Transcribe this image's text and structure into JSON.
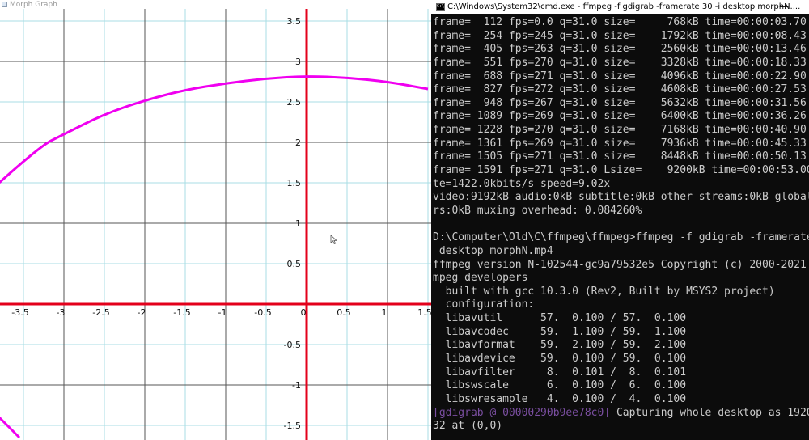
{
  "graph_window": {
    "title": "Morph Graph",
    "colors": {
      "background": "#ffffff",
      "minor_grid": "#a8dde4",
      "major_grid": "#555555",
      "axes": "#e3001b",
      "curve": "#f000f0"
    },
    "x_ticks": [
      "-3.5",
      "-3",
      "-2.5",
      "-2",
      "-1.5",
      "-1",
      "-0.5",
      "0",
      "0.5",
      "1",
      "1.5"
    ],
    "y_ticks": [
      "3.5",
      "3",
      "2.5",
      "2",
      "1.5",
      "1",
      "0.5",
      "-0.5",
      "-1",
      "-1.5"
    ],
    "curve": {
      "description_type": "arc",
      "points": [
        [
          -3.8,
          1.5
        ],
        [
          -3.3,
          1.95
        ],
        [
          -3.0,
          2.1
        ],
        [
          -2.5,
          2.35
        ],
        [
          -2.0,
          2.52
        ],
        [
          -1.5,
          2.65
        ],
        [
          -1.0,
          2.73
        ],
        [
          -0.5,
          2.79
        ],
        [
          0.0,
          2.82
        ],
        [
          0.5,
          2.8
        ],
        [
          1.0,
          2.75
        ],
        [
          1.5,
          2.66
        ]
      ],
      "lower_points": [
        [
          -3.8,
          -1.4
        ],
        [
          -3.65,
          -1.55
        ],
        [
          -3.55,
          -1.65
        ]
      ]
    }
  },
  "console_window": {
    "title": "C:\\Windows\\System32\\cmd.exe - ffmpeg  -f gdigrab -framerate 30 -i desktop morphN....",
    "minimize_label": "—",
    "icon_label": "C:\\",
    "lines": [
      "frame=  112 fps=0.0 q=31.0 size=     768kB time=00:00:03.70",
      "frame=  254 fps=245 q=31.0 size=    1792kB time=00:00:08.43",
      "frame=  405 fps=263 q=31.0 size=    2560kB time=00:00:13.46",
      "frame=  551 fps=270 q=31.0 size=    3328kB time=00:00:18.33",
      "frame=  688 fps=271 q=31.0 size=    4096kB time=00:00:22.90",
      "frame=  827 fps=272 q=31.0 size=    4608kB time=00:00:27.53",
      "frame=  948 fps=267 q=31.0 size=    5632kB time=00:00:31.56",
      "frame= 1089 fps=269 q=31.0 size=    6400kB time=00:00:36.26",
      "frame= 1228 fps=270 q=31.0 size=    7168kB time=00:00:40.90",
      "frame= 1361 fps=269 q=31.0 size=    7936kB time=00:00:45.33",
      "frame= 1505 fps=271 q=31.0 size=    8448kB time=00:00:50.13",
      "frame= 1591 fps=271 q=31.0 Lsize=    9200kB time=00:00:53.00",
      "te=1422.0kbits/s speed=9.02x",
      "video:9192kB audio:0kB subtitle:0kB other streams:0kB global",
      "rs:0kB muxing overhead: 0.084260%",
      "",
      "D:\\Computer\\Old\\C\\ffmpeg\\ffmpeg>ffmpeg -f gdigrab -framerate",
      " desktop morphN.mp4",
      "ffmpeg version N-102544-gc9a79532e5 Copyright (c) 2000-2021",
      "mpeg developers",
      "  built with gcc 10.3.0 (Rev2, Built by MSYS2 project)",
      "  configuration:",
      "  libavutil      57.  0.100 / 57.  0.100",
      "  libavcodec     59.  1.100 / 59.  1.100",
      "  libavformat    59.  2.100 / 59.  2.100",
      "  libavdevice    59.  0.100 / 59.  0.100",
      "  libavfilter     8.  0.101 /  8.  0.101",
      "  libswscale      6.  0.100 /  6.  0.100",
      "  libswresample   4.  0.100 /  4.  0.100"
    ],
    "warning_prefix": "[gdigrab @ 00000290b9ee78c0]",
    "warning_text": " Capturing whole desktop as 1920",
    "last_line": "32 at (0,0)"
  }
}
